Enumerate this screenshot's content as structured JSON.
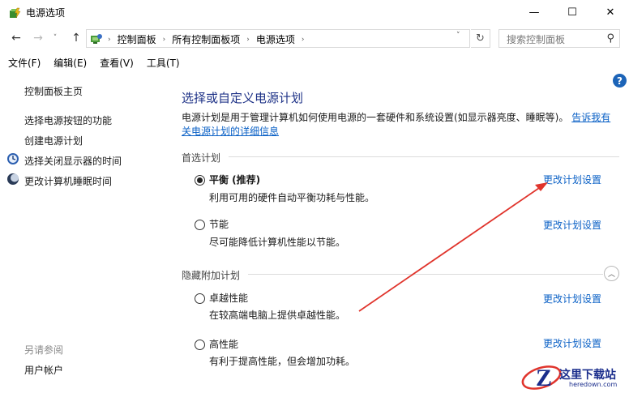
{
  "window": {
    "title": "电源选项",
    "minimize": "—",
    "maximize": "☐",
    "close": "✕"
  },
  "nav": {
    "back": "←",
    "forward": "→",
    "recent": "˅",
    "up": "↑",
    "breadcrumb": [
      "控制面板",
      "所有控制面板项",
      "电源选项"
    ],
    "breadcrumb_sep": "›",
    "dropdown": "˅",
    "refresh": "↻",
    "search_placeholder": "搜索控制面板",
    "search_glyph": "⚲"
  },
  "menu": [
    "文件(F)",
    "编辑(E)",
    "查看(V)",
    "工具(T)"
  ],
  "sidebar": {
    "links": [
      "控制面板主页",
      "选择电源按钮的功能",
      "创建电源计划",
      "选择关闭显示器的时间",
      "更改计算机睡眠时间"
    ],
    "see_also_heading": "另请参阅",
    "see_also_links": [
      "用户帐户"
    ]
  },
  "help_glyph": "?",
  "main": {
    "title": "选择或自定义电源计划",
    "description": "电源计划是用于管理计算机如何使用电源的一套硬件和系统设置(如显示器亮度、睡眠等)。",
    "description_link": "告诉我有关电源计划的详细信息",
    "preferred_heading": "首选计划",
    "hidden_heading": "隐藏附加计划",
    "collapse_glyph": "︿",
    "change_link": "更改计划设置",
    "plans": [
      {
        "name": "平衡 (推荐)",
        "desc": "利用可用的硬件自动平衡功耗与性能。",
        "selected": true
      },
      {
        "name": "节能",
        "desc": "尽可能降低计算机性能以节能。",
        "selected": false
      },
      {
        "name": "卓越性能",
        "desc": "在较高端电脑上提供卓越性能。",
        "selected": false
      },
      {
        "name": "高性能",
        "desc": "有利于提高性能，但会增加功耗。",
        "selected": false
      }
    ]
  },
  "watermark": {
    "text": "这里下载站",
    "sub": "heredown.com"
  },
  "colors": {
    "title_blue": "#1e3287",
    "link_blue": "#0b61c6",
    "arrow_red": "#e0342c",
    "help_blue": "#1c64b8"
  }
}
